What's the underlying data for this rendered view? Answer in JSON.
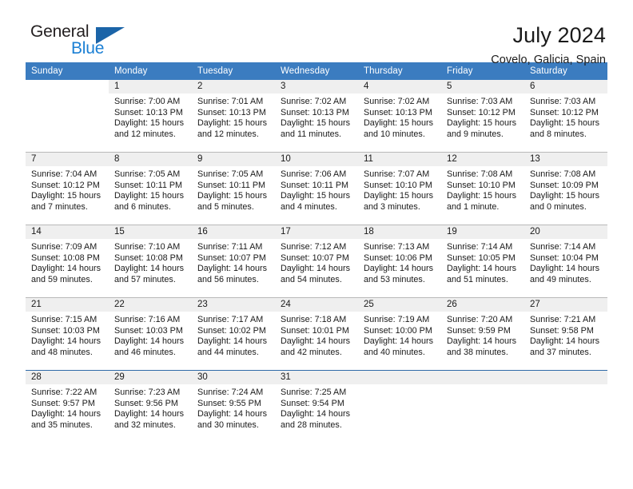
{
  "brand": {
    "name_part1": "General",
    "name_part2": "Blue",
    "triangle_color": "#1b64a8",
    "blue_color": "#1a7fd4"
  },
  "header": {
    "title": "July 2024",
    "subtitle": "Covelo, Galicia, Spain",
    "header_bg": "#3b7cc0",
    "daynum_bg": "#efefef"
  },
  "weekdays": [
    "Sunday",
    "Monday",
    "Tuesday",
    "Wednesday",
    "Thursday",
    "Friday",
    "Saturday"
  ],
  "weeks": [
    {
      "days": [
        {
          "num": "",
          "blank": true,
          "lines": []
        },
        {
          "num": "1",
          "lines": [
            "Sunrise: 7:00 AM",
            "Sunset: 10:13 PM",
            "Daylight: 15 hours",
            "and 12 minutes."
          ]
        },
        {
          "num": "2",
          "lines": [
            "Sunrise: 7:01 AM",
            "Sunset: 10:13 PM",
            "Daylight: 15 hours",
            "and 12 minutes."
          ]
        },
        {
          "num": "3",
          "lines": [
            "Sunrise: 7:02 AM",
            "Sunset: 10:13 PM",
            "Daylight: 15 hours",
            "and 11 minutes."
          ]
        },
        {
          "num": "4",
          "lines": [
            "Sunrise: 7:02 AM",
            "Sunset: 10:13 PM",
            "Daylight: 15 hours",
            "and 10 minutes."
          ]
        },
        {
          "num": "5",
          "lines": [
            "Sunrise: 7:03 AM",
            "Sunset: 10:12 PM",
            "Daylight: 15 hours",
            "and 9 minutes."
          ]
        },
        {
          "num": "6",
          "lines": [
            "Sunrise: 7:03 AM",
            "Sunset: 10:12 PM",
            "Daylight: 15 hours",
            "and 8 minutes."
          ]
        }
      ]
    },
    {
      "days": [
        {
          "num": "7",
          "lines": [
            "Sunrise: 7:04 AM",
            "Sunset: 10:12 PM",
            "Daylight: 15 hours",
            "and 7 minutes."
          ]
        },
        {
          "num": "8",
          "lines": [
            "Sunrise: 7:05 AM",
            "Sunset: 10:11 PM",
            "Daylight: 15 hours",
            "and 6 minutes."
          ]
        },
        {
          "num": "9",
          "lines": [
            "Sunrise: 7:05 AM",
            "Sunset: 10:11 PM",
            "Daylight: 15 hours",
            "and 5 minutes."
          ]
        },
        {
          "num": "10",
          "lines": [
            "Sunrise: 7:06 AM",
            "Sunset: 10:11 PM",
            "Daylight: 15 hours",
            "and 4 minutes."
          ]
        },
        {
          "num": "11",
          "lines": [
            "Sunrise: 7:07 AM",
            "Sunset: 10:10 PM",
            "Daylight: 15 hours",
            "and 3 minutes."
          ]
        },
        {
          "num": "12",
          "lines": [
            "Sunrise: 7:08 AM",
            "Sunset: 10:10 PM",
            "Daylight: 15 hours",
            "and 1 minute."
          ]
        },
        {
          "num": "13",
          "lines": [
            "Sunrise: 7:08 AM",
            "Sunset: 10:09 PM",
            "Daylight: 15 hours",
            "and 0 minutes."
          ]
        }
      ]
    },
    {
      "days": [
        {
          "num": "14",
          "lines": [
            "Sunrise: 7:09 AM",
            "Sunset: 10:08 PM",
            "Daylight: 14 hours",
            "and 59 minutes."
          ]
        },
        {
          "num": "15",
          "lines": [
            "Sunrise: 7:10 AM",
            "Sunset: 10:08 PM",
            "Daylight: 14 hours",
            "and 57 minutes."
          ]
        },
        {
          "num": "16",
          "lines": [
            "Sunrise: 7:11 AM",
            "Sunset: 10:07 PM",
            "Daylight: 14 hours",
            "and 56 minutes."
          ]
        },
        {
          "num": "17",
          "lines": [
            "Sunrise: 7:12 AM",
            "Sunset: 10:07 PM",
            "Daylight: 14 hours",
            "and 54 minutes."
          ]
        },
        {
          "num": "18",
          "lines": [
            "Sunrise: 7:13 AM",
            "Sunset: 10:06 PM",
            "Daylight: 14 hours",
            "and 53 minutes."
          ]
        },
        {
          "num": "19",
          "lines": [
            "Sunrise: 7:14 AM",
            "Sunset: 10:05 PM",
            "Daylight: 14 hours",
            "and 51 minutes."
          ]
        },
        {
          "num": "20",
          "lines": [
            "Sunrise: 7:14 AM",
            "Sunset: 10:04 PM",
            "Daylight: 14 hours",
            "and 49 minutes."
          ]
        }
      ]
    },
    {
      "days": [
        {
          "num": "21",
          "lines": [
            "Sunrise: 7:15 AM",
            "Sunset: 10:03 PM",
            "Daylight: 14 hours",
            "and 48 minutes."
          ]
        },
        {
          "num": "22",
          "lines": [
            "Sunrise: 7:16 AM",
            "Sunset: 10:03 PM",
            "Daylight: 14 hours",
            "and 46 minutes."
          ]
        },
        {
          "num": "23",
          "lines": [
            "Sunrise: 7:17 AM",
            "Sunset: 10:02 PM",
            "Daylight: 14 hours",
            "and 44 minutes."
          ]
        },
        {
          "num": "24",
          "lines": [
            "Sunrise: 7:18 AM",
            "Sunset: 10:01 PM",
            "Daylight: 14 hours",
            "and 42 minutes."
          ]
        },
        {
          "num": "25",
          "lines": [
            "Sunrise: 7:19 AM",
            "Sunset: 10:00 PM",
            "Daylight: 14 hours",
            "and 40 minutes."
          ]
        },
        {
          "num": "26",
          "lines": [
            "Sunrise: 7:20 AM",
            "Sunset: 9:59 PM",
            "Daylight: 14 hours",
            "and 38 minutes."
          ]
        },
        {
          "num": "27",
          "lines": [
            "Sunrise: 7:21 AM",
            "Sunset: 9:58 PM",
            "Daylight: 14 hours",
            "and 37 minutes."
          ]
        }
      ]
    },
    {
      "days": [
        {
          "num": "28",
          "lines": [
            "Sunrise: 7:22 AM",
            "Sunset: 9:57 PM",
            "Daylight: 14 hours",
            "and 35 minutes."
          ]
        },
        {
          "num": "29",
          "lines": [
            "Sunrise: 7:23 AM",
            "Sunset: 9:56 PM",
            "Daylight: 14 hours",
            "and 32 minutes."
          ]
        },
        {
          "num": "30",
          "lines": [
            "Sunrise: 7:24 AM",
            "Sunset: 9:55 PM",
            "Daylight: 14 hours",
            "and 30 minutes."
          ]
        },
        {
          "num": "31",
          "lines": [
            "Sunrise: 7:25 AM",
            "Sunset: 9:54 PM",
            "Daylight: 14 hours",
            "and 28 minutes."
          ]
        },
        {
          "num": "",
          "empty": true,
          "lines": []
        },
        {
          "num": "",
          "empty": true,
          "lines": []
        },
        {
          "num": "",
          "empty": true,
          "lines": []
        }
      ]
    }
  ]
}
